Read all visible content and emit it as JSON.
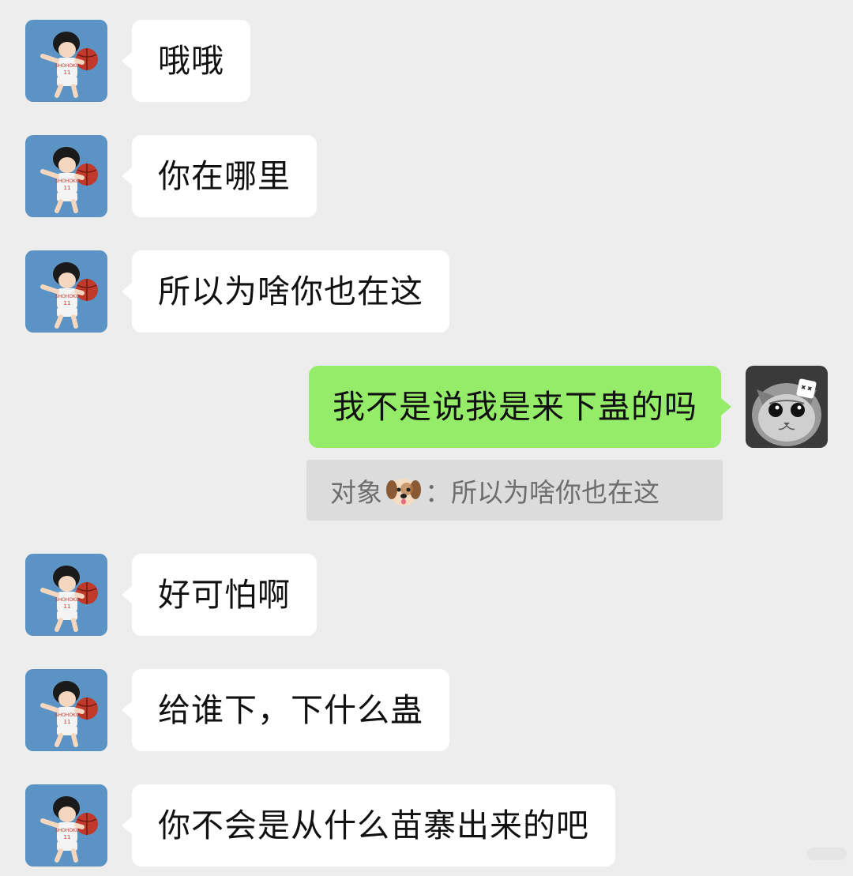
{
  "messages": [
    {
      "side": "in",
      "text": "哦哦",
      "avatar": "basketball-player-avatar"
    },
    {
      "side": "in",
      "text": "你在哪里",
      "avatar": "basketball-player-avatar"
    },
    {
      "side": "in",
      "text": "所以为啥你也在这",
      "avatar": "basketball-player-avatar"
    },
    {
      "side": "out",
      "text": "我不是说我是来下蛊的吗",
      "avatar": "kitten-avatar"
    },
    {
      "side": "in",
      "text": "好可怕啊",
      "avatar": "basketball-player-avatar"
    },
    {
      "side": "in",
      "text": "给谁下，下什么蛊",
      "avatar": "basketball-player-avatar"
    },
    {
      "side": "in",
      "text": "你不会是从什么苗寨出来的吧",
      "avatar": "basketball-player-avatar"
    }
  ],
  "quote": {
    "sender": "对象",
    "emoji": "dog-face-emoji",
    "separator": "：",
    "text": "所以为啥你也在这"
  },
  "colors": {
    "background": "#ededed",
    "incoming_bubble": "#ffffff",
    "outgoing_bubble": "#95ec69",
    "quote_bg": "#dcdcdc",
    "quote_text": "#6d6d6d"
  }
}
